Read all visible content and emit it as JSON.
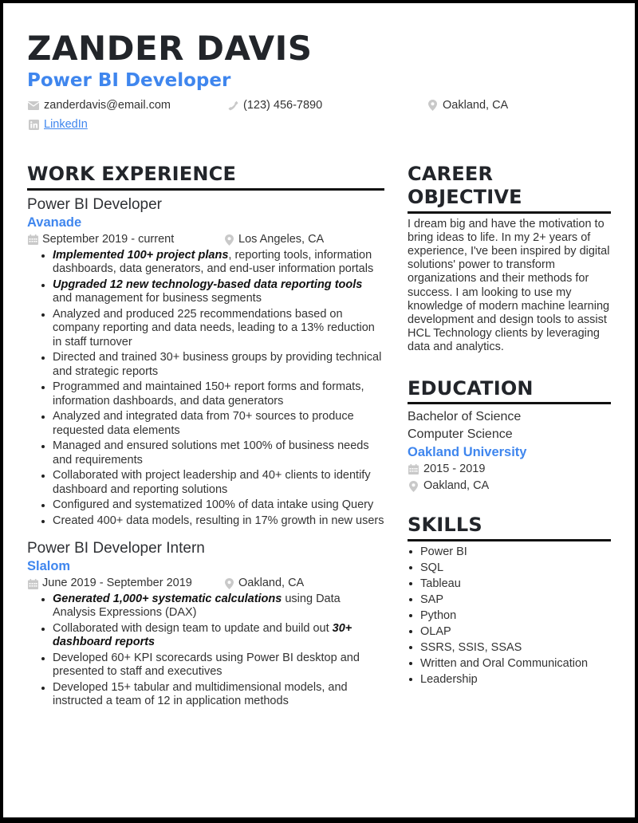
{
  "header": {
    "name": "ZANDER DAVIS",
    "title": "Power BI Developer",
    "contact": {
      "email": "zanderdavis@email.com",
      "phone": "(123) 456-7890",
      "location": "Oakland, CA",
      "linkedin_label": "LinkedIn"
    },
    "icons": {
      "email": "envelope-icon",
      "phone": "phone-icon",
      "location": "map-pin-icon",
      "linkedin": "linkedin-icon",
      "date": "calendar-icon"
    },
    "accent_color": "#3f86ee"
  },
  "work_experience": {
    "heading": "WORK EXPERIENCE",
    "jobs": [
      {
        "title": "Power BI Developer",
        "company": "Avanade",
        "dates": "September 2019 - current",
        "location": "Los Angeles, CA",
        "bullets": [
          {
            "bold": "Implemented 100+ project plans",
            "text": ", reporting tools, information dashboards, data generators, and end-user information portals"
          },
          {
            "bold": "Upgraded 12 new technology-based data reporting tools",
            "text": " and management for business segments"
          },
          {
            "bold": "",
            "text": "Analyzed and produced 225 recommendations based on company reporting and data needs, leading to a 13% reduction in staff turnover"
          },
          {
            "bold": "",
            "text": "Directed and trained 30+ business groups by providing technical and strategic reports"
          },
          {
            "bold": "",
            "text": "Programmed and maintained 150+ report forms and formats, information dashboards, and data generators"
          },
          {
            "bold": "",
            "text": "Analyzed and integrated data from 70+ sources to produce requested data elements"
          },
          {
            "bold": "",
            "text": "Managed and ensured solutions met 100% of business needs and requirements"
          },
          {
            "bold": "",
            "text": "Collaborated with project leadership and 40+ clients to identify dashboard and reporting solutions"
          },
          {
            "bold": "",
            "text": "Configured and systematized 100% of data intake using Query"
          },
          {
            "bold": "",
            "text": "Created 400+ data models, resulting in 17% growth in new users"
          }
        ]
      },
      {
        "title": "Power BI Developer Intern",
        "company": "Slalom",
        "dates": "June 2019 - September 2019",
        "location": "Oakland, CA",
        "bullets": [
          {
            "bold": "Generated 1,000+ systematic calculations",
            "text": " using Data Analysis Expressions (DAX)"
          },
          {
            "pre": "Collaborated with design team to update and build out ",
            "bold": "30+ dashboard reports",
            "text": ""
          },
          {
            "bold": "",
            "text": "Developed 60+ KPI scorecards using Power BI desktop and presented to staff and executives"
          },
          {
            "bold": "",
            "text": "Developed 15+ tabular and multidimensional models, and instructed a team of 12 in application methods"
          }
        ]
      }
    ]
  },
  "career_objective": {
    "heading": "CAREER OBJECTIVE",
    "text": "I dream big and have the motivation to bring ideas to life. In my 2+ years of experience, I've been inspired by digital solutions' power to transform organizations and their methods for success. I am looking to use my knowledge of modern machine learning development and design tools to assist HCL Technology clients by leveraging data and analytics."
  },
  "education": {
    "heading": "EDUCATION",
    "degree": "Bachelor of Science",
    "field": "Computer Science",
    "school": "Oakland University",
    "dates": "2015 - 2019",
    "location": "Oakland, CA"
  },
  "skills": {
    "heading": "SKILLS",
    "items": [
      "Power BI",
      "SQL",
      "Tableau",
      "SAP",
      "Python",
      "OLAP",
      "SSRS, SSIS, SSAS",
      "Written and Oral Communication",
      "Leadership"
    ]
  }
}
